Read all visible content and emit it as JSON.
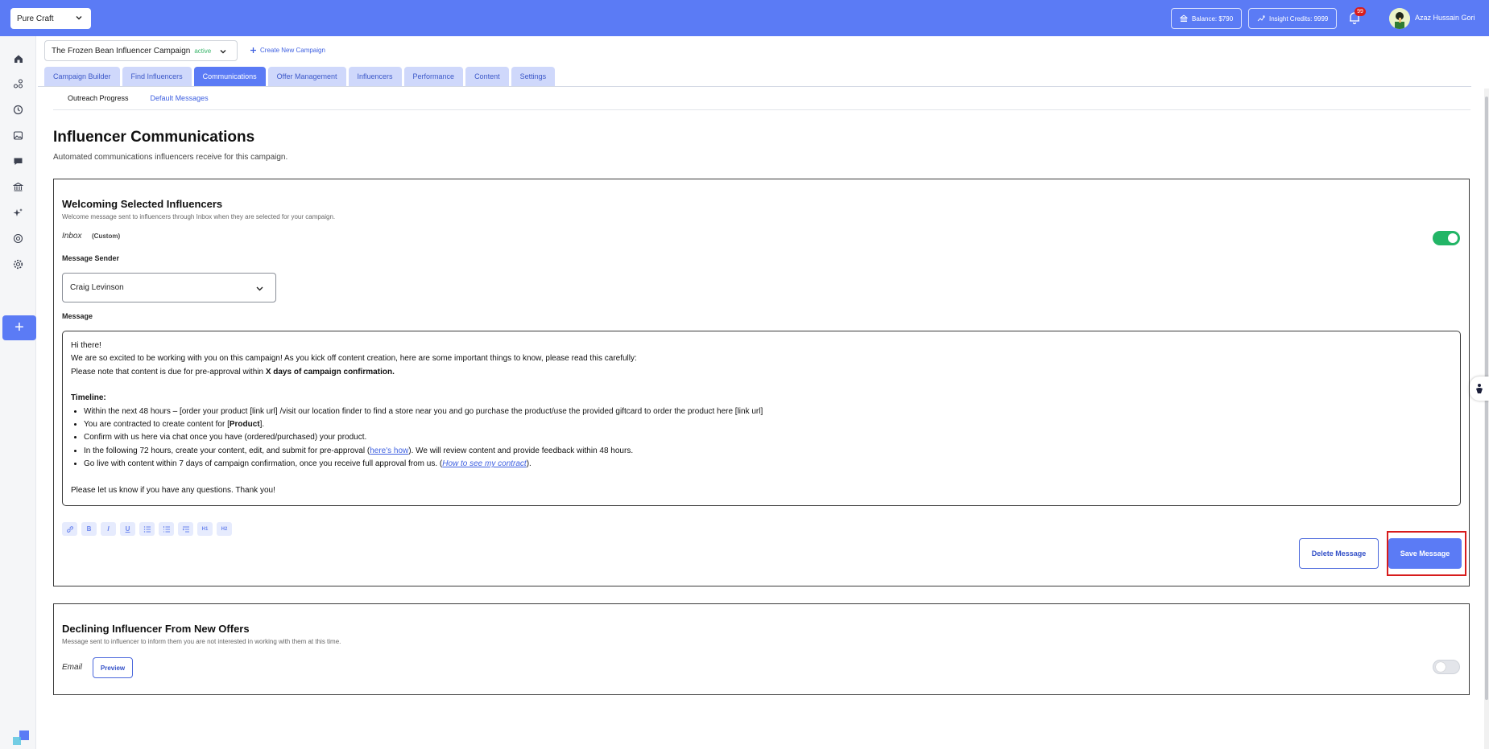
{
  "topbar": {
    "brand_select": "Pure Craft",
    "balance": "Balance: $790",
    "insight_credits": "Insight Credits: 9999",
    "notification_count": "99",
    "user_name": "Azaz Hussain Gori",
    "bg_color": "#5b7bf5"
  },
  "sidebar": {
    "icons": [
      "home-icon",
      "network-icon",
      "clock-icon",
      "image-icon",
      "chat-icon",
      "bank-icon",
      "sparkle-icon",
      "target-icon",
      "gear-icon"
    ],
    "add_label": "+"
  },
  "campaign": {
    "name": "The Frozen Bean Influencer Campaign",
    "status": "active",
    "create_new": "Create New Campaign"
  },
  "tabs": [
    {
      "label": "Campaign Builder",
      "active": false
    },
    {
      "label": "Find Influencers",
      "active": false
    },
    {
      "label": "Communications",
      "active": true
    },
    {
      "label": "Offer Management",
      "active": false
    },
    {
      "label": "Influencers",
      "active": false
    },
    {
      "label": "Performance",
      "active": false
    },
    {
      "label": "Content",
      "active": false
    },
    {
      "label": "Settings",
      "active": false
    }
  ],
  "subtabs": [
    {
      "label": "Outreach Progress",
      "active": false
    },
    {
      "label": "Default Messages",
      "active": true
    }
  ],
  "page": {
    "title": "Influencer Communications",
    "subtitle": "Automated communications influencers receive for this campaign."
  },
  "welcome_card": {
    "title": "Welcoming Selected Influencers",
    "description": "Welcome message sent to influencers through Inbox when they are selected for your campaign.",
    "channel": "Inbox",
    "channel_tag": "(Custom)",
    "enabled": true,
    "sender_label": "Message Sender",
    "sender_value": "Craig Levinson",
    "message_label": "Message",
    "message": {
      "greeting": "Hi there!",
      "intro": "We are so excited to be working with you on this campaign! As you kick off content creation, here are some important things to know, please read this carefully:",
      "note_prefix": "Please note that content is due for pre-approval within ",
      "note_bold": "X days of campaign confirmation.",
      "timeline_heading": "Timeline:",
      "item1": "Within the next 48 hours – [order your product [link url] /visit our location finder to find a store near you and go purchase the product/use the provided giftcard to order the product here [link url]",
      "item2_prefix": "You are contracted to create content for [",
      "item2_bold": "Product",
      "item2_suffix": "].",
      "item3": "Confirm with us here via chat once you have (ordered/purchased) your product.",
      "item4_prefix": "In the following 72 hours, create your content, edit, and submit for pre-approval (",
      "item4_link": "here's how",
      "item4_suffix": "). We will review content and provide feedback within 48 hours.",
      "item5_prefix": "Go live with content within 7 days of campaign confirmation, once you receive full approval from us. (",
      "item5_link": "How to see my contract",
      "item5_suffix": ").",
      "closing": "Please let us know if you have any questions. Thank you!"
    },
    "toolbar": [
      "link-icon",
      "B",
      "I",
      "U",
      "bullet-list-icon",
      "numbered-list-icon",
      "indent-list-icon",
      "H1",
      "H2"
    ],
    "delete_label": "Delete Message",
    "save_label": "Save Message"
  },
  "decline_card": {
    "title": "Declining Influencer From New Offers",
    "description": "Message sent to influencer to inform them you are not interested in working with them at this time.",
    "channel": "Email",
    "preview_label": "Preview",
    "enabled": false
  }
}
